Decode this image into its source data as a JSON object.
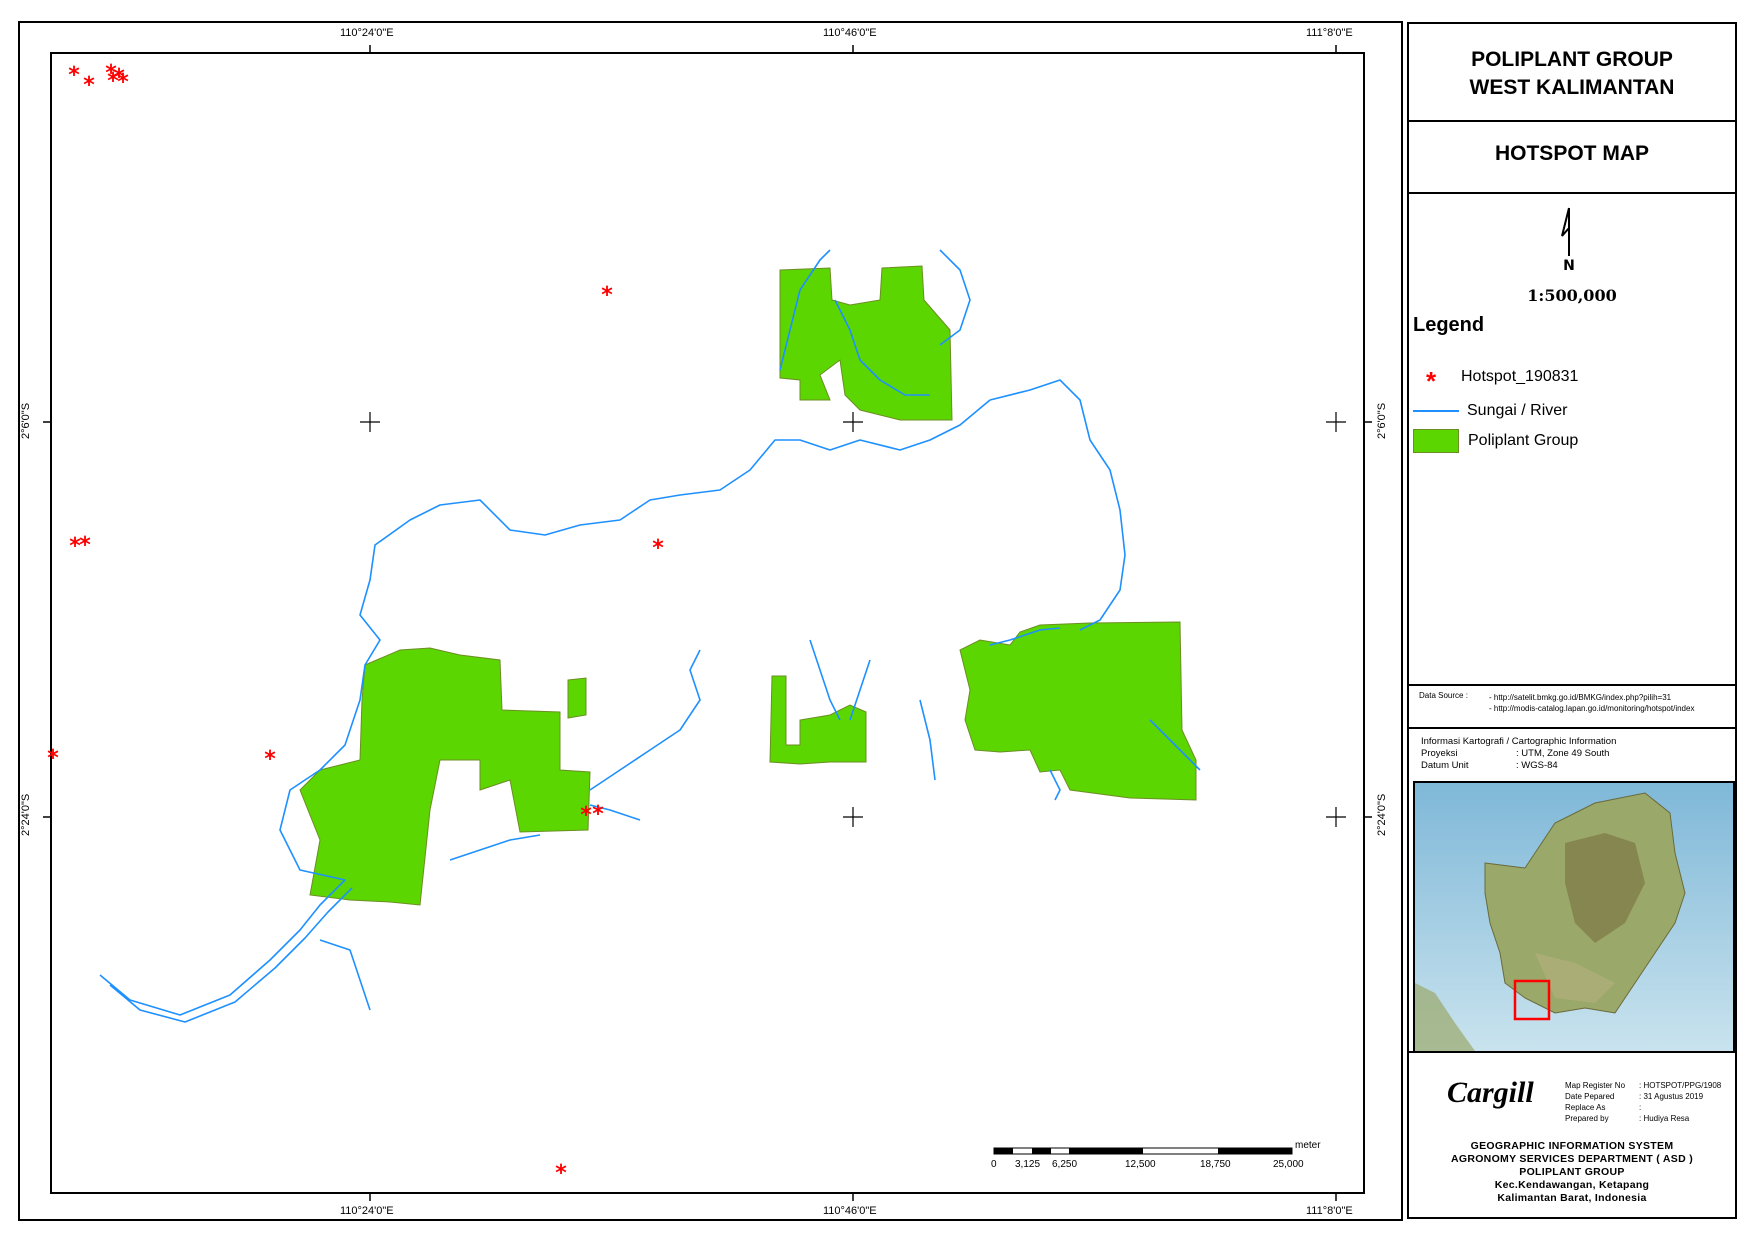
{
  "title": {
    "line1": "POLIPLANT GROUP",
    "line2": "WEST KALIMANTAN",
    "map_type": "HOTSPOT MAP"
  },
  "scale_ratio": "1:500,000",
  "north_label": "N",
  "legend": {
    "title": "Legend",
    "items": [
      {
        "label": "Hotspot_190831",
        "symbol": "asterisk",
        "color": "#ff0000"
      },
      {
        "label": "Sungai / River",
        "symbol": "line",
        "color": "#1e90ff"
      },
      {
        "label": "Poliplant Group",
        "symbol": "fill",
        "color": "#5cd600"
      }
    ]
  },
  "data_source": {
    "label": "Data Source :",
    "lines": [
      "- http://satelit.bmkg.go.id/BMKG/index.php?pilih=31",
      "- http://modis-catalog.lapan.go.id/monitoring/hotspot/index"
    ]
  },
  "cartographic": {
    "heading": "Informasi Kartografi / Cartographic Information",
    "rows": [
      {
        "key": "Proyeksi",
        "value": ": UTM, Zone 49 South"
      },
      {
        "key": "Datum Unit",
        "value": ": WGS-84"
      }
    ]
  },
  "register": {
    "rows": [
      {
        "key": "Map Register No",
        "value": ": HOTSPOT/PPG/1908"
      },
      {
        "key": "Date Pepared",
        "value": ": 31 Agustus 2019"
      },
      {
        "key": "Replace As",
        "value": ":"
      },
      {
        "key": "Prepared by",
        "value": ": Hudiya Resa"
      }
    ]
  },
  "logo_text": "Cargill",
  "footer": {
    "lines": [
      "GEOGRAPHIC INFORMATION SYSTEM",
      "AGRONOMY SERVICES DEPARTMENT ( ASD )",
      "POLIPLANT GROUP",
      "Kec.Kendawangan, Ketapang",
      "Kalimantan Barat, Indonesia"
    ]
  },
  "graticule": {
    "lon_labels": [
      "110°24'0\"E",
      "110°46'0\"E",
      "111°8'0\"E"
    ],
    "lat_labels": [
      "2°6'0\"S",
      "2°24'0\"S"
    ]
  },
  "scalebar": {
    "unit": "meter",
    "ticks": [
      "0",
      "3,125",
      "6,250",
      "12,500",
      "18,750",
      "25,000"
    ]
  },
  "colors": {
    "river": "#1e90ff",
    "plantation": "#5cd600",
    "hotspot": "#ff0000",
    "inset_box": "#ff0000"
  }
}
